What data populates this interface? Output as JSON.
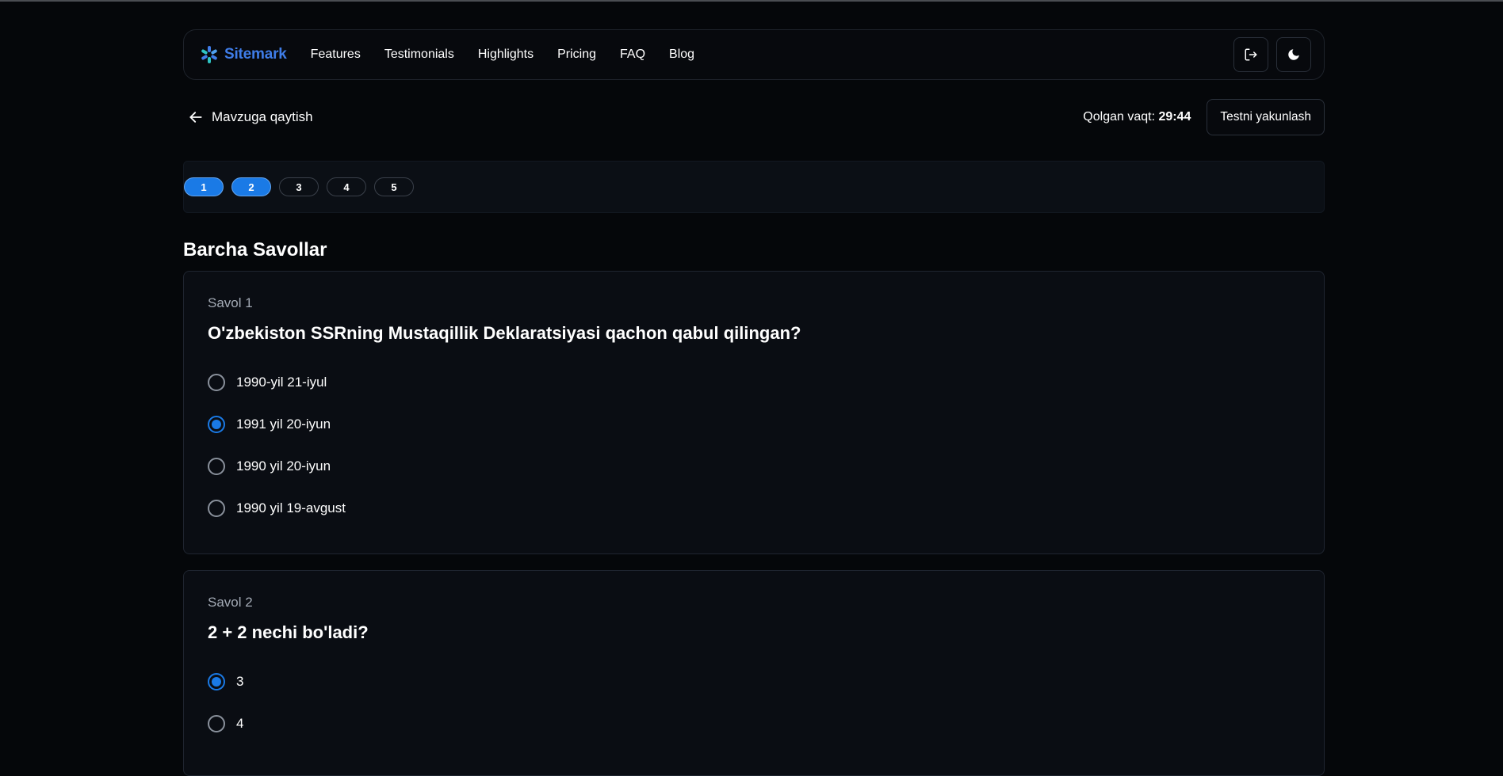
{
  "brand": {
    "name": "Sitemark",
    "icon": "sitemark-logo-icon"
  },
  "nav": {
    "links": [
      "Features",
      "Testimonials",
      "Highlights",
      "Pricing",
      "FAQ",
      "Blog"
    ],
    "actions": [
      {
        "icon": "logout-icon"
      },
      {
        "icon": "moon-icon"
      }
    ]
  },
  "header": {
    "back_label": "Mavzuga qaytish",
    "timer_label": "Qolgan vaqt:",
    "timer_value": "29:44",
    "finish_label": "Testni yakunlash"
  },
  "pager": {
    "pages": [
      "1",
      "2",
      "3",
      "4",
      "5"
    ],
    "answered": [
      true,
      true,
      false,
      false,
      false
    ]
  },
  "section_title": "Barcha Savollar",
  "questions": [
    {
      "number": "Savol 1",
      "text": "O'zbekiston SSRning Mustaqillik Deklaratsiyasi qachon qabul qilingan?",
      "options": [
        "1990-yil 21-iyul",
        "1991 yil 20-iyun",
        "1990 yil 20-iyun",
        "1990 yil 19-avgust"
      ],
      "selected": 1
    },
    {
      "number": "Savol 2",
      "text": "2 + 2 nechi bo'ladi?",
      "options": [
        "3",
        "4"
      ],
      "selected": 0
    }
  ],
  "colors": {
    "accent": "#1a7ae6",
    "brand": "#3f7de8",
    "background": "#05070a"
  }
}
